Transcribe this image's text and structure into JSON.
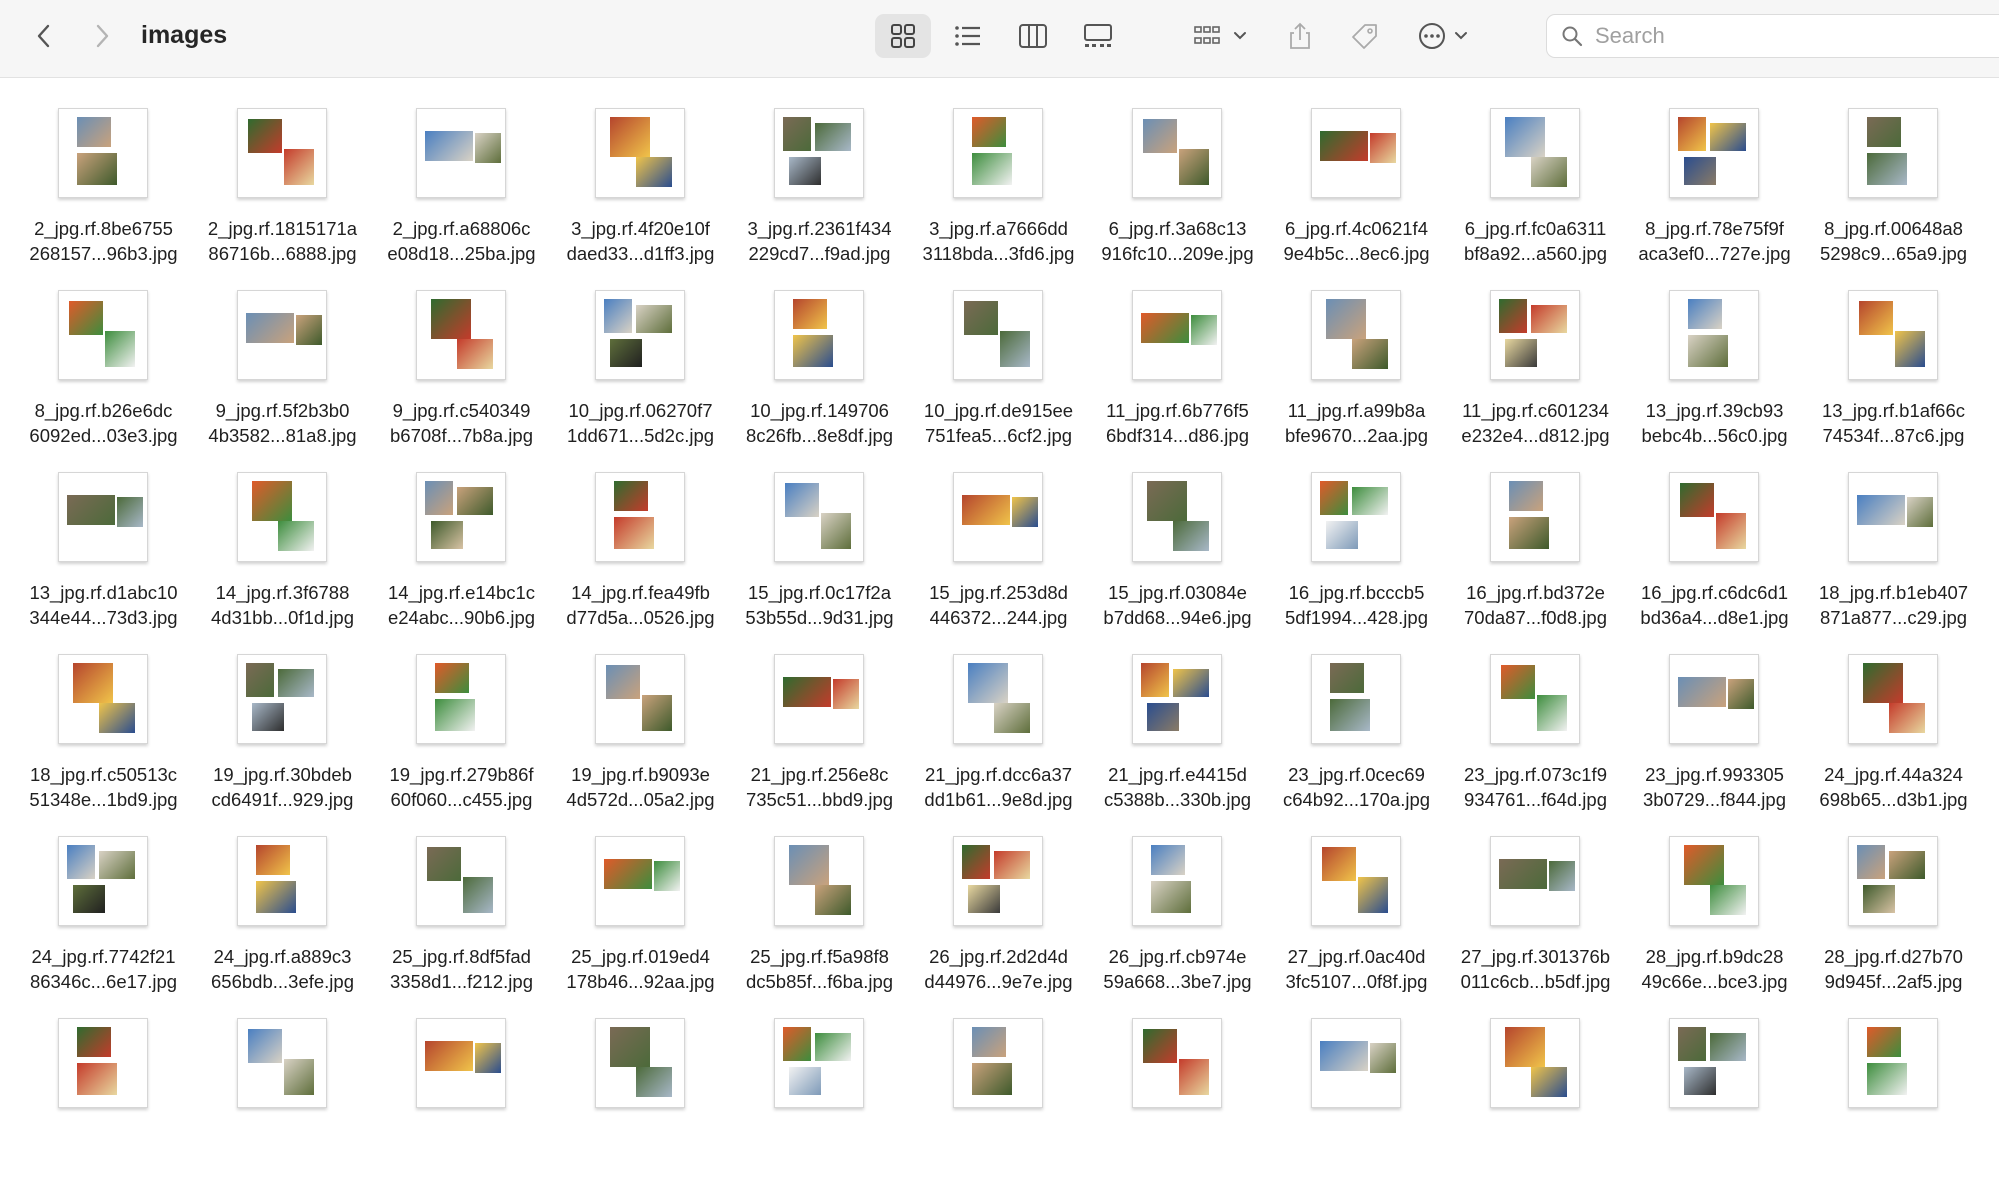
{
  "window": {
    "title": "images",
    "back_icon": "chevron-left-icon",
    "forward_icon": "chevron-right-icon",
    "search_placeholder": "Search",
    "active_view": "icon-view"
  },
  "toolbar": {
    "views": [
      "icon-view",
      "list-view",
      "column-view",
      "gallery-view"
    ],
    "tools": [
      "group-by-icon",
      "share-icon",
      "tag-icon",
      "more-actions-icon"
    ]
  },
  "colors": {
    "toolbar_bg": "#f6f6f6",
    "active_view_bg": "#e4e4e4",
    "text": "#1f1f1f"
  },
  "files": [
    {
      "line1": "2_jpg.rf.8be6755",
      "line2": "268157...96b3.jpg"
    },
    {
      "line1": "2_jpg.rf.1815171a",
      "line2": "86716b...6888.jpg"
    },
    {
      "line1": "2_jpg.rf.a68806c",
      "line2": "e08d18...25ba.jpg"
    },
    {
      "line1": "3_jpg.rf.4f20e10f",
      "line2": "daed33...d1ff3.jpg"
    },
    {
      "line1": "3_jpg.rf.2361f434",
      "line2": "229cd7...f9ad.jpg"
    },
    {
      "line1": "3_jpg.rf.a7666dd",
      "line2": "3118bda...3fd6.jpg"
    },
    {
      "line1": "6_jpg.rf.3a68c13",
      "line2": "916fc10...209e.jpg"
    },
    {
      "line1": "6_jpg.rf.4c0621f4",
      "line2": "9e4b5c...8ec6.jpg"
    },
    {
      "line1": "6_jpg.rf.fc0a6311",
      "line2": "bf8a92...a560.jpg"
    },
    {
      "line1": "8_jpg.rf.78e75f9f",
      "line2": "aca3ef0...727e.jpg"
    },
    {
      "line1": "8_jpg.rf.00648a8",
      "line2": "5298c9...65a9.jpg"
    },
    {
      "line1": "8_jpg.rf.b26e6dc",
      "line2": "6092ed...03e3.jpg"
    },
    {
      "line1": "9_jpg.rf.5f2b3b0",
      "line2": "4b3582...81a8.jpg"
    },
    {
      "line1": "9_jpg.rf.c540349",
      "line2": "b6708f...7b8a.jpg"
    },
    {
      "line1": "10_jpg.rf.06270f7",
      "line2": "1dd671...5d2c.jpg"
    },
    {
      "line1": "10_jpg.rf.149706",
      "line2": "8c26fb...8e8df.jpg"
    },
    {
      "line1": "10_jpg.rf.de915ee",
      "line2": "751fea5...6cf2.jpg"
    },
    {
      "line1": "11_jpg.rf.6b776f5",
      "line2": "6bdf314...d86.jpg"
    },
    {
      "line1": "11_jpg.rf.a99b8a",
      "line2": "bfe9670...2aa.jpg"
    },
    {
      "line1": "11_jpg.rf.c601234",
      "line2": "e232e4...d812.jpg"
    },
    {
      "line1": "13_jpg.rf.39cb93",
      "line2": "bebc4b...56c0.jpg"
    },
    {
      "line1": "13_jpg.rf.b1af66c",
      "line2": "74534f...87c6.jpg"
    },
    {
      "line1": "13_jpg.rf.d1abc10",
      "line2": "344e44...73d3.jpg"
    },
    {
      "line1": "14_jpg.rf.3f6788",
      "line2": "4d31bb...0f1d.jpg"
    },
    {
      "line1": "14_jpg.rf.e14bc1c",
      "line2": "e24abc...90b6.jpg"
    },
    {
      "line1": "14_jpg.rf.fea49fb",
      "line2": "d77d5a...0526.jpg"
    },
    {
      "line1": "15_jpg.rf.0c17f2a",
      "line2": "53b55d...9d31.jpg"
    },
    {
      "line1": "15_jpg.rf.253d8d",
      "line2": "446372...244.jpg"
    },
    {
      "line1": "15_jpg.rf.03084e",
      "line2": "b7dd68...94e6.jpg"
    },
    {
      "line1": "16_jpg.rf.bcccb5",
      "line2": "5df1994...428.jpg"
    },
    {
      "line1": "16_jpg.rf.bd372e",
      "line2": "70da87...f0d8.jpg"
    },
    {
      "line1": "16_jpg.rf.c6dc6d1",
      "line2": "bd36a4...d8e1.jpg"
    },
    {
      "line1": "18_jpg.rf.b1eb407",
      "line2": "871a877...c29.jpg"
    },
    {
      "line1": "18_jpg.rf.c50513c",
      "line2": "51348e...1bd9.jpg"
    },
    {
      "line1": "19_jpg.rf.30bdeb",
      "line2": "cd6491f...929.jpg"
    },
    {
      "line1": "19_jpg.rf.279b86f",
      "line2": "60f060...c455.jpg"
    },
    {
      "line1": "19_jpg.rf.b9093e",
      "line2": "4d572d...05a2.jpg"
    },
    {
      "line1": "21_jpg.rf.256e8c",
      "line2": "735c51...bbd9.jpg"
    },
    {
      "line1": "21_jpg.rf.dcc6a37",
      "line2": "dd1b61...9e8d.jpg"
    },
    {
      "line1": "21_jpg.rf.e4415d",
      "line2": "c5388b...330b.jpg"
    },
    {
      "line1": "23_jpg.rf.0cec69",
      "line2": "c64b92...170a.jpg"
    },
    {
      "line1": "23_jpg.rf.073c1f9",
      "line2": "934761...f64d.jpg"
    },
    {
      "line1": "23_jpg.rf.993305",
      "line2": "3b0729...f844.jpg"
    },
    {
      "line1": "24_jpg.rf.44a324",
      "line2": "698b65...d3b1.jpg"
    },
    {
      "line1": "24_jpg.rf.7742f21",
      "line2": "86346c...6e17.jpg"
    },
    {
      "line1": "24_jpg.rf.a889c3",
      "line2": "656bdb...3efe.jpg"
    },
    {
      "line1": "25_jpg.rf.8df5fad",
      "line2": "3358d1...f212.jpg"
    },
    {
      "line1": "25_jpg.rf.019ed4",
      "line2": "178b46...92aa.jpg"
    },
    {
      "line1": "25_jpg.rf.f5a98f8",
      "line2": "dc5b85f...f6ba.jpg"
    },
    {
      "line1": "26_jpg.rf.2d2d4d",
      "line2": "d44976...9e7e.jpg"
    },
    {
      "line1": "26_jpg.rf.cb974e",
      "line2": "59a668...3be7.jpg"
    },
    {
      "line1": "27_jpg.rf.0ac40d",
      "line2": "3fc5107...0f8f.jpg"
    },
    {
      "line1": "27_jpg.rf.301376b",
      "line2": "011c6cb...b5df.jpg"
    },
    {
      "line1": "28_jpg.rf.b9dc28",
      "line2": "49c66e...bce3.jpg"
    },
    {
      "line1": "28_jpg.rf.d27b70",
      "line2": "9d945f...2af5.jpg"
    },
    {
      "line1": "",
      "line2": ""
    },
    {
      "line1": "",
      "line2": ""
    },
    {
      "line1": "",
      "line2": ""
    },
    {
      "line1": "",
      "line2": ""
    },
    {
      "line1": "",
      "line2": ""
    },
    {
      "line1": "",
      "line2": ""
    },
    {
      "line1": "",
      "line2": ""
    },
    {
      "line1": "",
      "line2": ""
    },
    {
      "line1": "",
      "line2": ""
    },
    {
      "line1": "",
      "line2": ""
    },
    {
      "line1": "",
      "line2": ""
    }
  ]
}
